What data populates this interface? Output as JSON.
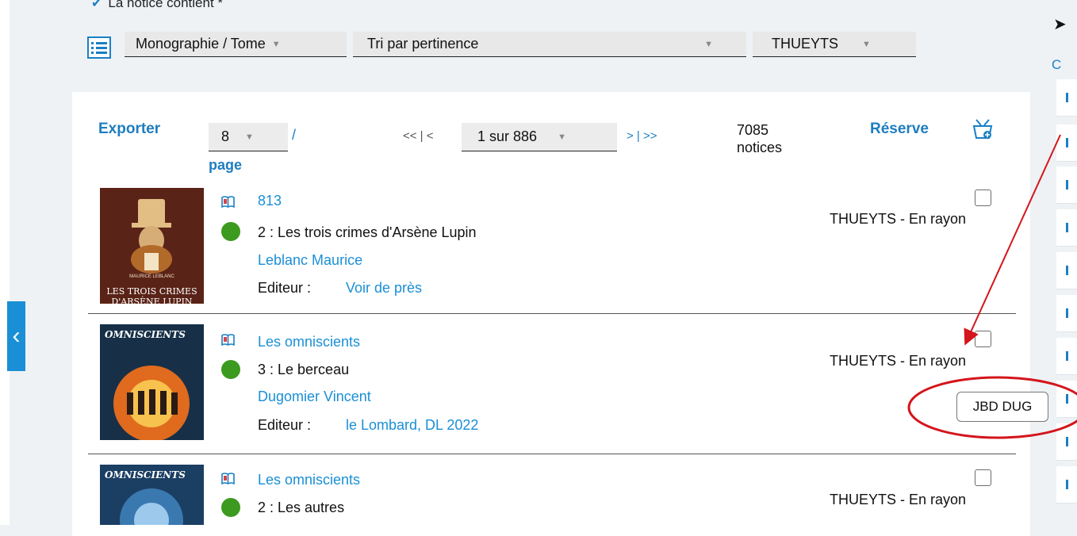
{
  "search": {
    "criteria_label": "La notice contient *",
    "filters": {
      "type_value": "Monographie / Tome",
      "sort_value": "Tri par pertinence",
      "library_value": "THUEYTS"
    }
  },
  "toolbar": {
    "export_label": "Exporter",
    "per_page_value": "8",
    "per_page_slash": "/",
    "per_page_label": "page",
    "pager_first": "<< | <",
    "pager_value": "1 sur 886",
    "pager_last": "> | >>",
    "count_number": "7085",
    "count_label": "notices",
    "reserve_label": "Réserve"
  },
  "records": [
    {
      "cover_title": "LES TROIS CRIMES",
      "cover_sub": "D'ARSÈNE LUPIN",
      "cover_author": "MAURICE LEBLANC",
      "series": "813",
      "title": "2 : Les trois crimes d'Arsène Lupin",
      "author": "Leblanc Maurice",
      "publisher_label": "Editeur :",
      "publisher": "Voir de près",
      "location": "THUEYTS - En rayon"
    },
    {
      "cover_title": "OMNISCIENTS",
      "series": "Les omniscients",
      "title": "3 : Le berceau",
      "author": "Dugomier Vincent",
      "publisher_label": "Editeur :",
      "publisher": "le Lombard, DL 2022",
      "location": "THUEYTS - En rayon",
      "call_number": "JBD DUG"
    },
    {
      "cover_title": "OMNISCIENTS",
      "series": "Les omniscients",
      "title": "2 : Les autres",
      "location": "THUEYTS - En rayon"
    }
  ],
  "side_panel": {
    "letter": "C"
  },
  "colors": {
    "accent": "#1a8fd6",
    "available": "#3c9a1e",
    "annotation": "#d4151b"
  }
}
